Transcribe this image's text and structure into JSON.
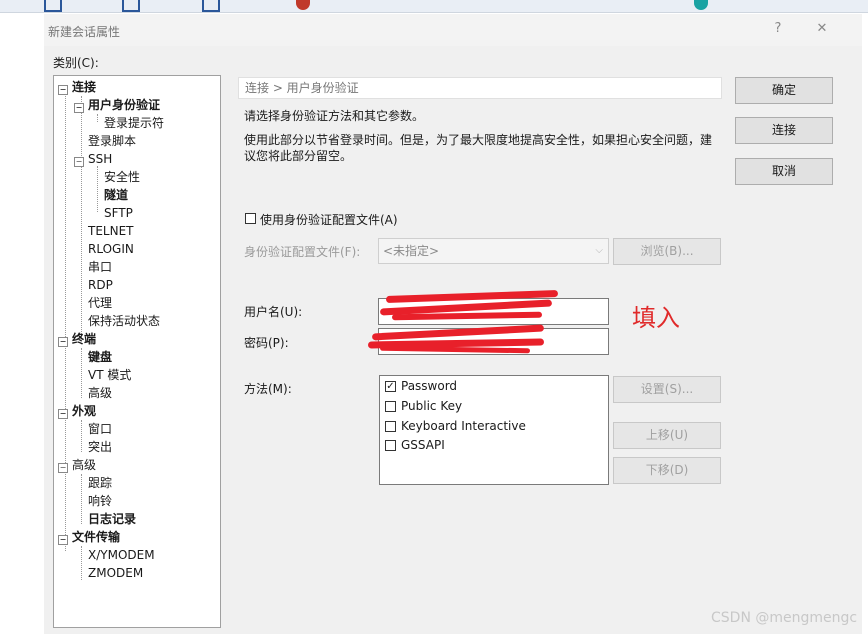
{
  "window": {
    "title": "新建会话属性",
    "help_label": "?",
    "close_label": "✕"
  },
  "category_label": "类别(C):",
  "tree": [
    {
      "label": "连接",
      "expander": "⊟"
    },
    {
      "label": "用户身份验证",
      "expander": "⊟"
    },
    {
      "label": "登录提示符"
    },
    {
      "label": "登录脚本"
    },
    {
      "label": "SSH",
      "expander": "⊟"
    },
    {
      "label": "安全性"
    },
    {
      "label": "隧道"
    },
    {
      "label": "SFTP"
    },
    {
      "label": "TELNET"
    },
    {
      "label": "RLOGIN"
    },
    {
      "label": "串口"
    },
    {
      "label": "RDP"
    },
    {
      "label": "代理"
    },
    {
      "label": "保持活动状态"
    },
    {
      "label": "终端",
      "expander": "⊟"
    },
    {
      "label": "键盘"
    },
    {
      "label": "VT 模式"
    },
    {
      "label": "高级"
    },
    {
      "label": "外观",
      "expander": "⊟"
    },
    {
      "label": "窗口"
    },
    {
      "label": "突出"
    },
    {
      "label": "高级",
      "expander": "⊟"
    },
    {
      "label": "跟踪"
    },
    {
      "label": "响铃"
    },
    {
      "label": "日志记录"
    },
    {
      "label": "文件传输",
      "expander": "⊟"
    },
    {
      "label": "X/YMODEM"
    },
    {
      "label": "ZMODEM"
    }
  ],
  "breadcrumb": "连接 > 用户身份验证",
  "description": {
    "line1": "请选择身份验证方法和其它参数。",
    "line2": "使用此部分以节省登录时间。但是，为了最大限度地提高安全性，如果担心安全问题，建",
    "line3": "议您将此部分留空。"
  },
  "use_profile": {
    "label": "使用身份验证配置文件(A)",
    "checked": false
  },
  "profile": {
    "label": "身份验证配置文件(F):",
    "value": "<未指定>",
    "browse_label": "浏览(B)..."
  },
  "username": {
    "label": "用户名(U):",
    "value": ""
  },
  "password": {
    "label": "密码(P):",
    "value": ""
  },
  "method": {
    "label": "方法(M):",
    "options": [
      {
        "label": "Password",
        "checked": true
      },
      {
        "label": "Public Key",
        "checked": false
      },
      {
        "label": "Keyboard Interactive",
        "checked": false
      },
      {
        "label": "GSSAPI",
        "checked": false
      }
    ],
    "settings_label": "设置(S)...",
    "move_up_label": "上移(U)",
    "move_down_label": "下移(D)"
  },
  "buttons": {
    "ok": "确定",
    "connect": "连接",
    "cancel": "取消"
  },
  "annotation": "填入",
  "watermark": "CSDN @mengmengc",
  "colors": {
    "annotation_red": "#e8202a",
    "dialog_bg": "#f0f0f0"
  }
}
